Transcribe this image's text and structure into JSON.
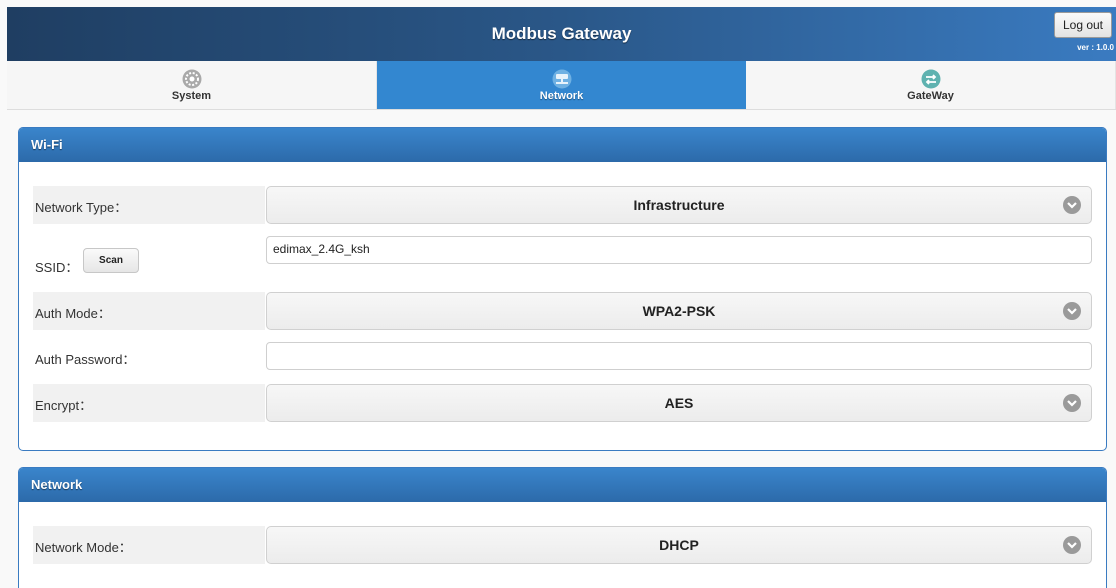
{
  "header": {
    "title": "Modbus Gateway",
    "logout_label": "Log out",
    "version": "ver : 1.0.0"
  },
  "nav": {
    "items": [
      {
        "label": "System",
        "icon": "gear-icon"
      },
      {
        "label": "Network",
        "icon": "network-icon"
      },
      {
        "label": "GateWay",
        "icon": "exchange-arrows-icon"
      }
    ],
    "active": "Network"
  },
  "wifi": {
    "title": "Wi-Fi",
    "network_type": {
      "label": "Network Type：",
      "value": "Infrastructure"
    },
    "ssid": {
      "label": "SSID：",
      "scan_label": "Scan",
      "value": "edimax_2.4G_ksh"
    },
    "auth_mode": {
      "label": "Auth Mode：",
      "value": "WPA2-PSK"
    },
    "auth_password": {
      "label": "Auth Password：",
      "value": ""
    },
    "encrypt": {
      "label": "Encrypt：",
      "value": "AES"
    }
  },
  "network": {
    "title": "Network",
    "network_mode": {
      "label": "Network Mode：",
      "value": "DHCP"
    }
  },
  "colors": {
    "header_gradient_start": "#1f3e62",
    "header_gradient_end": "#3a7bc1",
    "active_tab": "#3387d0",
    "panel_header": "#3a85cc"
  }
}
